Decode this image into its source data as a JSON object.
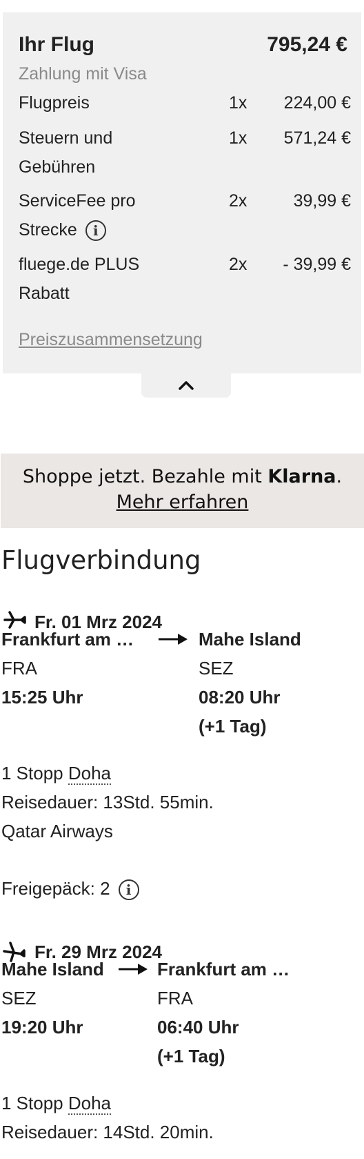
{
  "price": {
    "title": "Ihr Flug",
    "total": "795,24 €",
    "payment": "Zahlung mit Visa",
    "rows": [
      {
        "label_l1": "Flugpreis",
        "label_l2": "",
        "qty": "1x",
        "amount": "224,00 €"
      },
      {
        "label_l1": "Steuern und",
        "label_l2": "Gebühren",
        "qty": "1x",
        "amount": "571,24 €"
      },
      {
        "label_l1": "ServiceFee pro",
        "label_l2": "Strecke",
        "qty": "2x",
        "amount": "39,99 €"
      },
      {
        "label_l1": "fluege.de PLUS",
        "label_l2": "Rabatt",
        "qty": "2x",
        "amount": "- 39,99 €"
      }
    ],
    "breakdown_link": "Preiszusammensetzung",
    "info_glyph": "i"
  },
  "klarna": {
    "text": "Shoppe jetzt. Bezahle mit ",
    "brand": "Klarna",
    "dot": ".",
    "link": "Mehr erfahren"
  },
  "flight": {
    "title": "Flugverbindung",
    "outbound": {
      "date": "Fr. 01 Mrz 2024",
      "from_city": "Frankfurt am …",
      "to_city": "Mahe Island",
      "from_code": "FRA",
      "to_code": "SEZ",
      "dep_time": "15:25 Uhr",
      "arr_time": "08:20 Uhr",
      "arr_note": "(+1 Tag)",
      "stops_prefix": "1 Stopp ",
      "stop_city": "Doha",
      "duration": "Reisedauer: 13Std. 55min.",
      "airline": "Qatar Airways",
      "baggage": "Freigepäck: 2"
    },
    "return": {
      "date": "Fr. 29 Mrz 2024",
      "from_city": "Mahe Island",
      "to_city": "Frankfurt am …",
      "from_code": "SEZ",
      "to_code": "FRA",
      "dep_time": "19:20 Uhr",
      "arr_time": "06:40 Uhr",
      "arr_note": "(+1 Tag)",
      "stops_prefix": "1 Stopp ",
      "stop_city": "Doha",
      "duration": "Reisedauer: 14Std. 20min."
    }
  },
  "icons": {
    "info": "info-icon",
    "collapse": "chevron-up-icon",
    "departure": "plane-departure-icon",
    "arrival": "plane-arrival-icon",
    "arrow": "arrow-right-icon"
  }
}
